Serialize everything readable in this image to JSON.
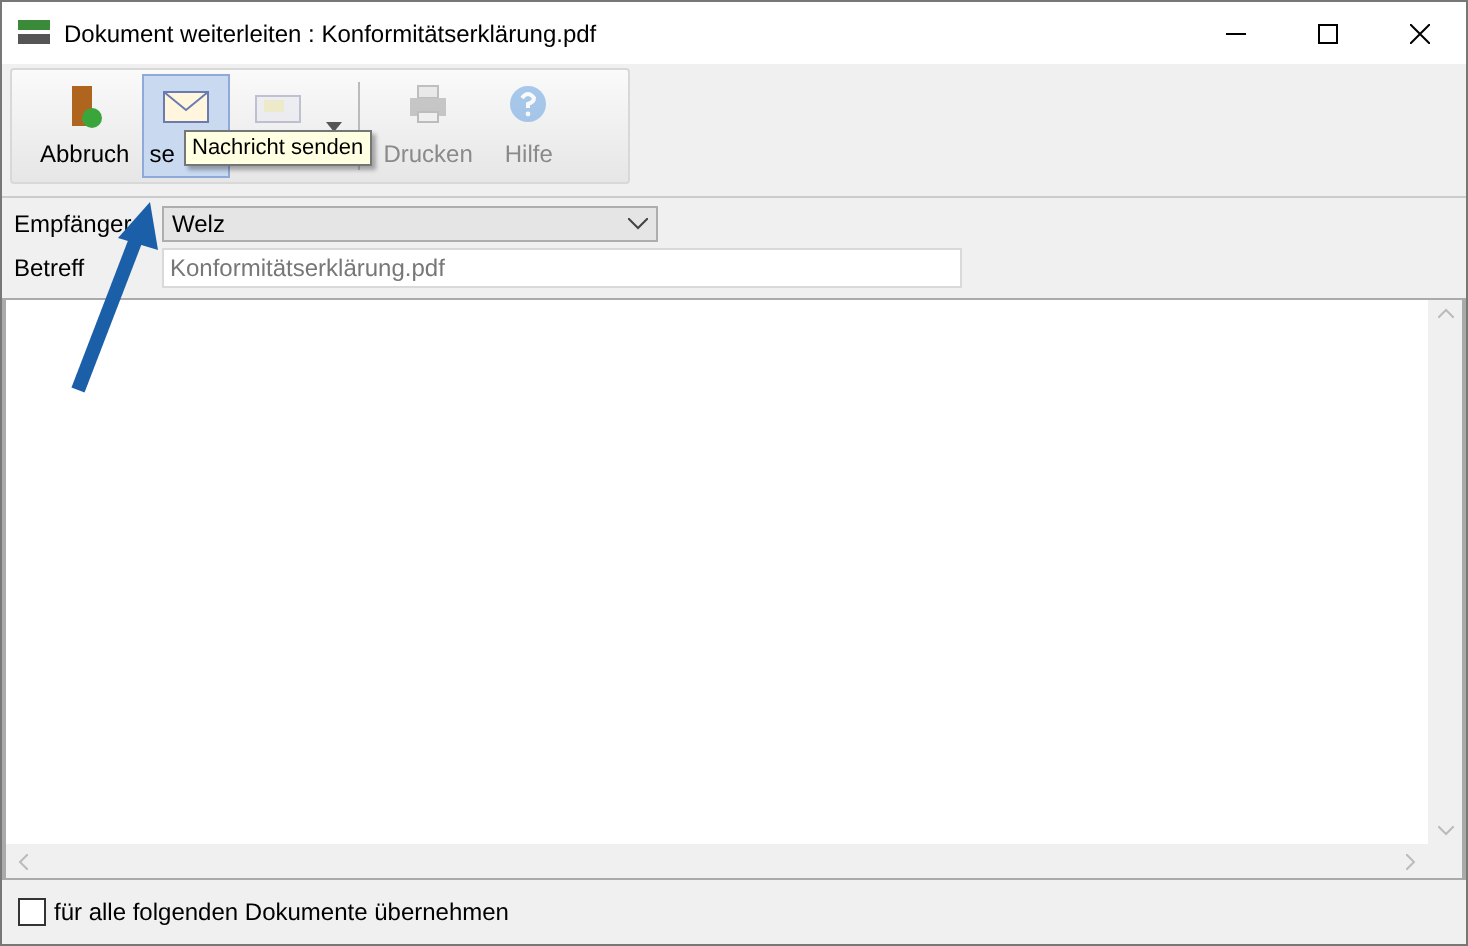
{
  "window": {
    "title": "Dokument weiterleiten : Konformitätserklärung.pdf"
  },
  "toolbar": {
    "buttons": [
      {
        "kind": "exit",
        "label": "Abbruch",
        "disabled": false,
        "selected": false
      },
      {
        "kind": "send",
        "label": "se",
        "disabled": false,
        "selected": true
      },
      {
        "kind": "reply",
        "disabled": true,
        "selected": false,
        "has_menu": true
      },
      {
        "kind": "print",
        "label": "Drucken",
        "disabled": true,
        "selected": false
      },
      {
        "kind": "help",
        "label": "Hilfe",
        "disabled": true,
        "selected": false
      }
    ]
  },
  "tooltip": {
    "text": "Nachricht senden"
  },
  "form": {
    "recipient": {
      "label": "Empfänger",
      "value": "Welz"
    },
    "subject": {
      "label": "Betreff",
      "value": "Konformitätserklärung.pdf"
    }
  },
  "options": [
    {
      "label": "für alle folgenden Dokumente übernehmen",
      "checked": false
    }
  ]
}
